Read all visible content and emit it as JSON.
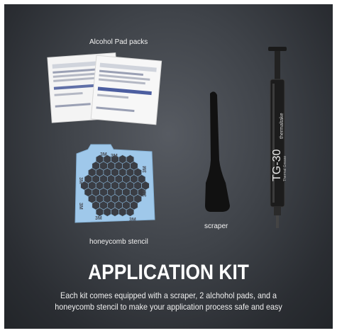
{
  "labels": {
    "alcohol": "Alcohol Pad packs",
    "scraper": "scraper",
    "stencil": "honeycomb stencil"
  },
  "title": "APPLICATION KIT",
  "caption": {
    "line1": "Each kit comes equipped with a scraper, 2 alchohol pads, and a",
    "line2": "honeycomb stencil to make your application process safe and easy"
  },
  "syringe": {
    "model": "TG-30",
    "brand": "thermaltake",
    "subtitle": "Thermal Grease"
  },
  "stencil_marks": [
    "3M",
    "3M",
    "3M",
    "3M",
    "3M",
    "3M",
    "3M",
    "3M"
  ],
  "colors": {
    "background": "#3f4349",
    "stencil": "#9fc8ea",
    "syringe": "#1a1a1a",
    "scraper": "#111111",
    "text": "#ffffff"
  }
}
